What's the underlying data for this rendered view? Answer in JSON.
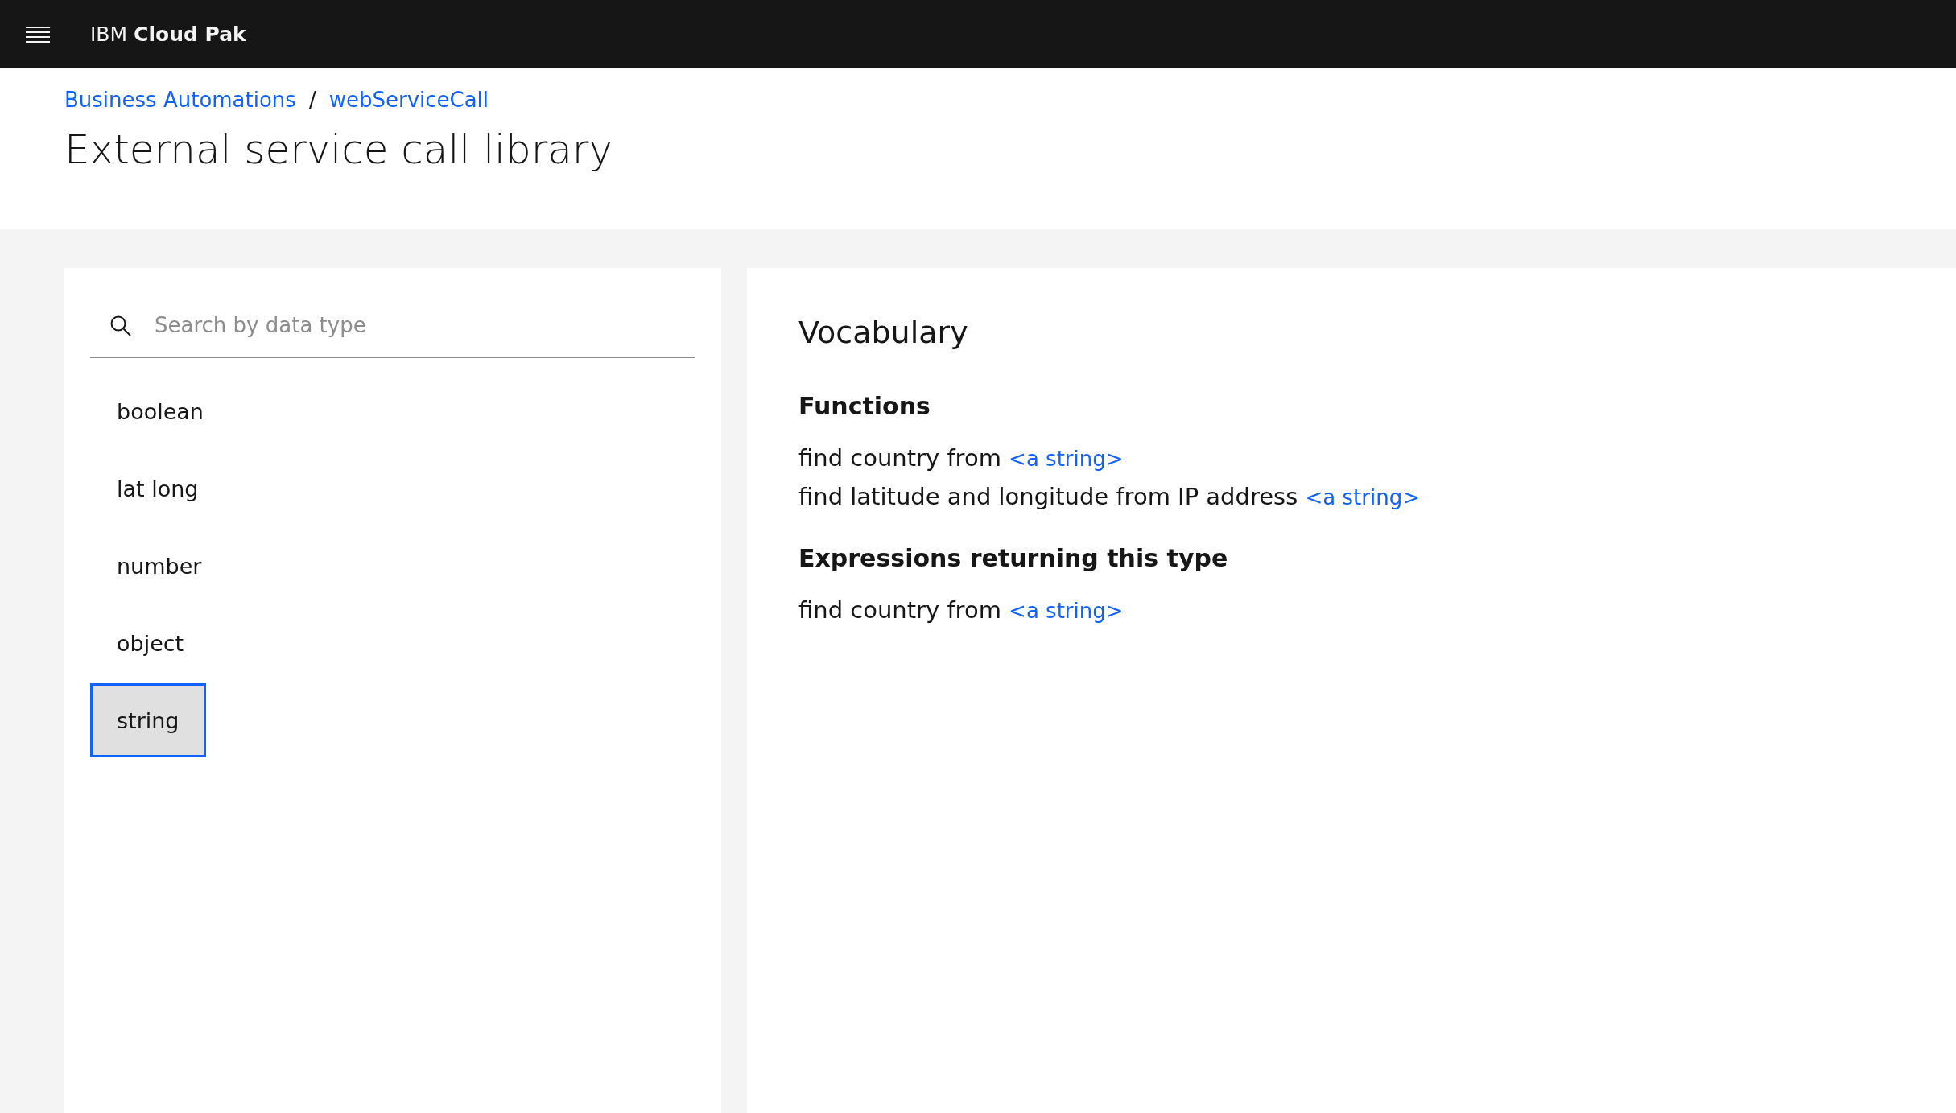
{
  "header": {
    "brand": "IBM **Cloud Pak**"
  },
  "breadcrumbs": {
    "items": [
      "Business Automations",
      "webServiceCall"
    ],
    "separator": "/"
  },
  "title": "External service call library",
  "search": {
    "placeholder": "Search by data type"
  },
  "data_types": [
    {
      "label": "boolean",
      "selected": false
    },
    {
      "label": "lat long",
      "selected": false
    },
    {
      "label": "number",
      "selected": false
    },
    {
      "label": "object",
      "selected": false
    },
    {
      "label": "string",
      "selected": true
    }
  ],
  "vocabulary": {
    "title": "Vocabulary",
    "sections": [
      {
        "heading": "Functions",
        "entries": [
          {
            "text": "find country from",
            "link": "<a string>"
          },
          {
            "text": "find latitude and longitude from IP address",
            "link": "<a string>"
          }
        ]
      },
      {
        "heading": "Expressions returning this type",
        "entries": [
          {
            "text": "find country from",
            "link": "<a string>"
          }
        ]
      }
    ]
  }
}
